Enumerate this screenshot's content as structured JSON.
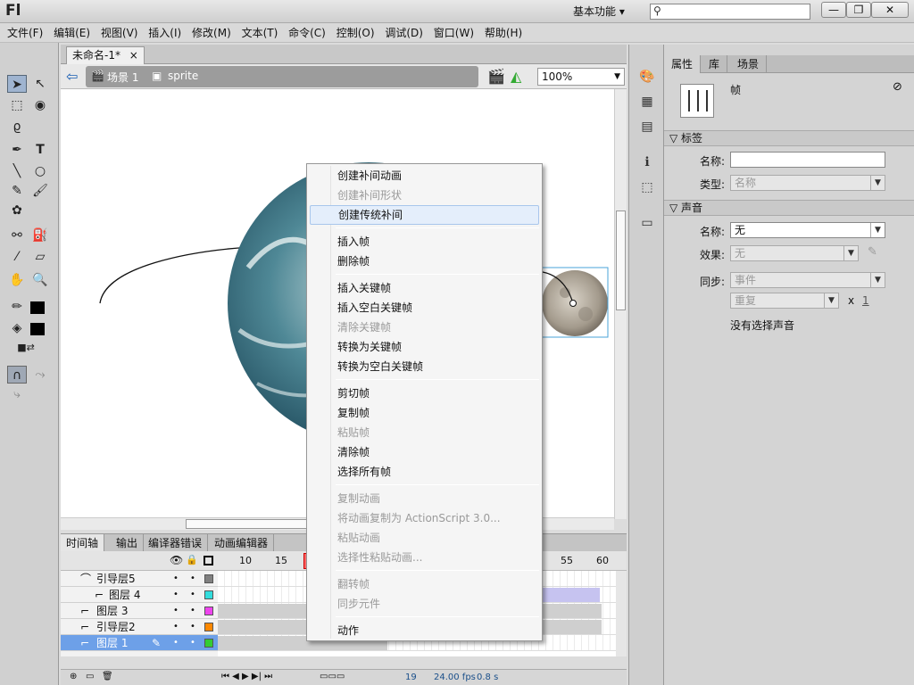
{
  "app": {
    "logo": "Fl",
    "workspace": "基本功能 ▾",
    "search_icon": "search-icon",
    "min": "—",
    "max": "❐",
    "close": "✕"
  },
  "menubar": [
    "文件(F)",
    "编辑(E)",
    "视图(V)",
    "插入(I)",
    "修改(M)",
    "文本(T)",
    "命令(C)",
    "控制(O)",
    "调试(D)",
    "窗口(W)",
    "帮助(H)"
  ],
  "document": {
    "tab": "未命名-1*",
    "tab_close": "×",
    "scene": "场景 1",
    "symbol": "sprite",
    "zoom": "100%"
  },
  "timeline": {
    "tabs": [
      "时间轴",
      "输出",
      "编译器错误",
      "动画编辑器"
    ],
    "frame_numbers": [
      "10",
      "15",
      "55",
      "60"
    ],
    "layers": [
      {
        "name": "引导层5",
        "color": "#808080"
      },
      {
        "name": "图层 4",
        "color": "#33dddd"
      },
      {
        "name": "图层 3",
        "color": "#ee44ee"
      },
      {
        "name": "引导层2",
        "color": "#ff8800"
      },
      {
        "name": "图层 1",
        "color": "#33cc33"
      }
    ],
    "footer": {
      "frame": "19",
      "fps": "24.00 fps",
      "time": "0.8 s"
    }
  },
  "panel": {
    "tabs": [
      "属性",
      "库",
      "场景"
    ],
    "title": "帧",
    "label_section": "标签",
    "name_label": "名称:",
    "type_label": "类型:",
    "type_value": "名称",
    "sound_section": "声音",
    "sound_name_label": "名称:",
    "sound_name_value": "无",
    "effect_label": "效果:",
    "effect_value": "无",
    "sync_label": "同步:",
    "sync_value": "事件",
    "repeat_value": "重复",
    "repeat_x": "x",
    "repeat_count": "1",
    "no_sound": "没有选择声音"
  },
  "context_menu": [
    {
      "label": "创建补间动画",
      "disabled": false
    },
    {
      "label": "创建补间形状",
      "disabled": true
    },
    {
      "label": "创建传统补间",
      "disabled": false
    },
    {
      "label": "插入帧",
      "disabled": false
    },
    {
      "label": "删除帧",
      "disabled": false
    },
    {
      "label": "插入关键帧",
      "disabled": false
    },
    {
      "label": "插入空白关键帧",
      "disabled": false
    },
    {
      "label": "清除关键帧",
      "disabled": true
    },
    {
      "label": "转换为关键帧",
      "disabled": false
    },
    {
      "label": "转换为空白关键帧",
      "disabled": false
    },
    {
      "label": "剪切帧",
      "disabled": false
    },
    {
      "label": "复制帧",
      "disabled": false
    },
    {
      "label": "粘贴帧",
      "disabled": true
    },
    {
      "label": "清除帧",
      "disabled": false
    },
    {
      "label": "选择所有帧",
      "disabled": false
    },
    {
      "label": "复制动画",
      "disabled": true
    },
    {
      "label": "将动画复制为 ActionScript 3.0...",
      "disabled": true
    },
    {
      "label": "粘贴动画",
      "disabled": true
    },
    {
      "label": "选择性粘贴动画...",
      "disabled": true
    },
    {
      "label": "翻转帧",
      "disabled": true
    },
    {
      "label": "同步元件",
      "disabled": true
    },
    {
      "label": "动作",
      "disabled": false
    }
  ]
}
